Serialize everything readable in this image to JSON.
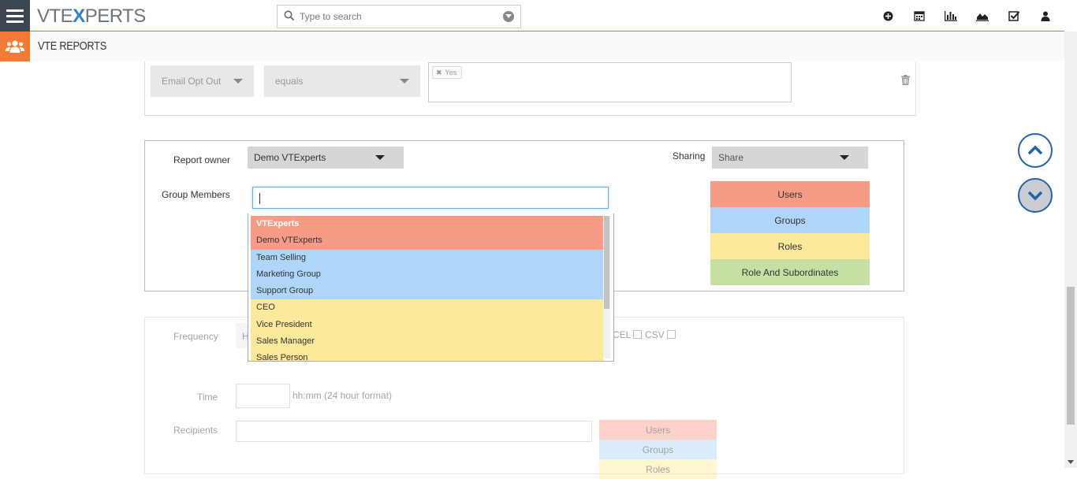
{
  "header": {
    "logo_prefix": "VTE",
    "logo_x": "X",
    "logo_suffix": "PERTS",
    "search_placeholder": "Type to search",
    "icons": [
      "plus-circle-icon",
      "calendar-icon",
      "bar-chart-icon",
      "area-chart-icon",
      "checkbox-icon",
      "user-icon"
    ]
  },
  "module": {
    "title": "VTE REPORTS",
    "icon": "users-group-icon"
  },
  "condition": {
    "field": "Email Opt Out",
    "operator": "equals",
    "value_tag": "Yes"
  },
  "sharing": {
    "report_owner_label": "Report owner",
    "report_owner_value": "Demo VTExperts",
    "sharing_label": "Sharing",
    "sharing_value": "Share",
    "group_members_label": "Group Members",
    "group_members_value": "",
    "legend": [
      "Users",
      "Groups",
      "Roles",
      "Role And Subordinates"
    ]
  },
  "dropdown": {
    "items": [
      {
        "label": "VTExperts",
        "type": "users",
        "header": true
      },
      {
        "label": "Demo VTExperts",
        "type": "users"
      },
      {
        "label": "Team Selling",
        "type": "groups"
      },
      {
        "label": "Marketing Group",
        "type": "groups"
      },
      {
        "label": "Support Group",
        "type": "groups"
      },
      {
        "label": "CEO",
        "type": "roles"
      },
      {
        "label": "Vice President",
        "type": "roles"
      },
      {
        "label": "Sales Manager",
        "type": "roles"
      },
      {
        "label": "Sales Person",
        "type": "roles"
      }
    ]
  },
  "schedule": {
    "frequency_label": "Frequency",
    "frequency_value": "H",
    "format_excel": "CEL",
    "format_csv": "CSV",
    "time_label": "Time",
    "time_hint": "hh:mm (24 hour format)",
    "recipients_label": "Recipients",
    "legend": [
      "Users",
      "Groups",
      "Roles"
    ]
  },
  "colors": {
    "users": "#f79a86",
    "groups": "#aed6f9",
    "roles": "#fde99b",
    "role_and_subordinates": "#c6e0a4",
    "accent": "#f47a35"
  }
}
